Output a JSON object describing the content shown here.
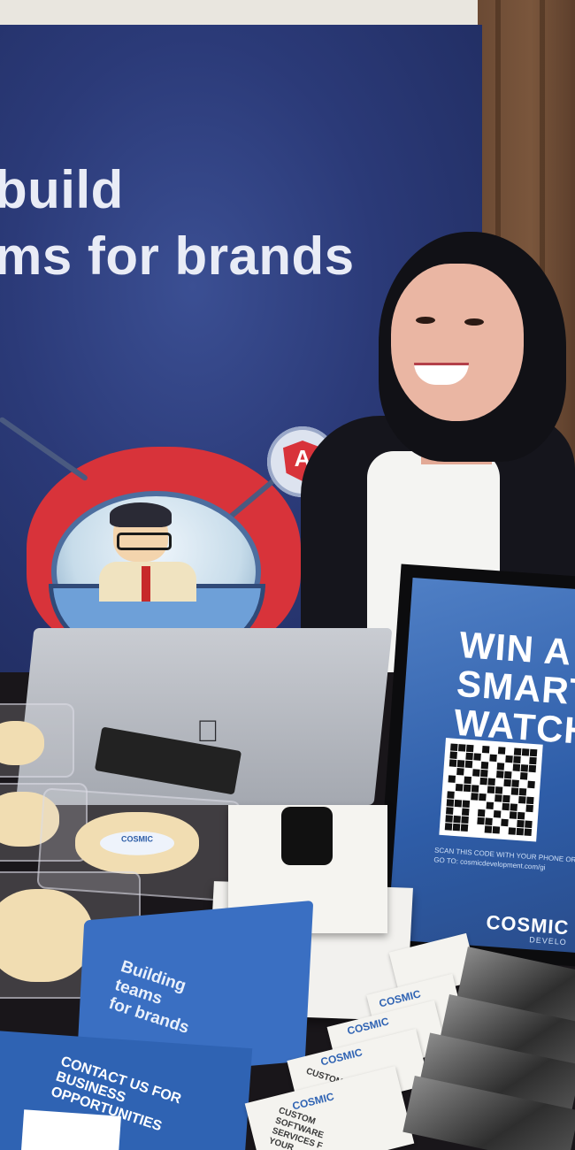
{
  "banner": {
    "line1": "build",
    "line2": "ms for brands",
    "angular_letter": "A"
  },
  "poster": {
    "line1": "WIN A",
    "line2": "SMART",
    "line3": "WATCH",
    "instructions": "SCAN THIS CODE WITH YOUR PHONE OR GO TO: cosmicdevelopment.com/gi",
    "brand": "COSMIC",
    "sub": "DEVELO"
  },
  "cloth": {
    "line1": "Building",
    "line2": "teams",
    "line3": "for brands"
  },
  "flyer": {
    "line1": "CONTACT US FOR",
    "line2": "BUSINESS",
    "line3": "OPPORTUNITIES"
  },
  "cards": {
    "brand": "COSMIC",
    "text1": "CUSTOM",
    "text2": "SOFTWARE",
    "text3": "SERVICES F",
    "text4": "YOUR"
  },
  "cake_label": "COSMIC",
  "colors": {
    "banner": "#2b3a78",
    "brand_blue": "#2f63b3",
    "heart_red": "#d8333a"
  }
}
